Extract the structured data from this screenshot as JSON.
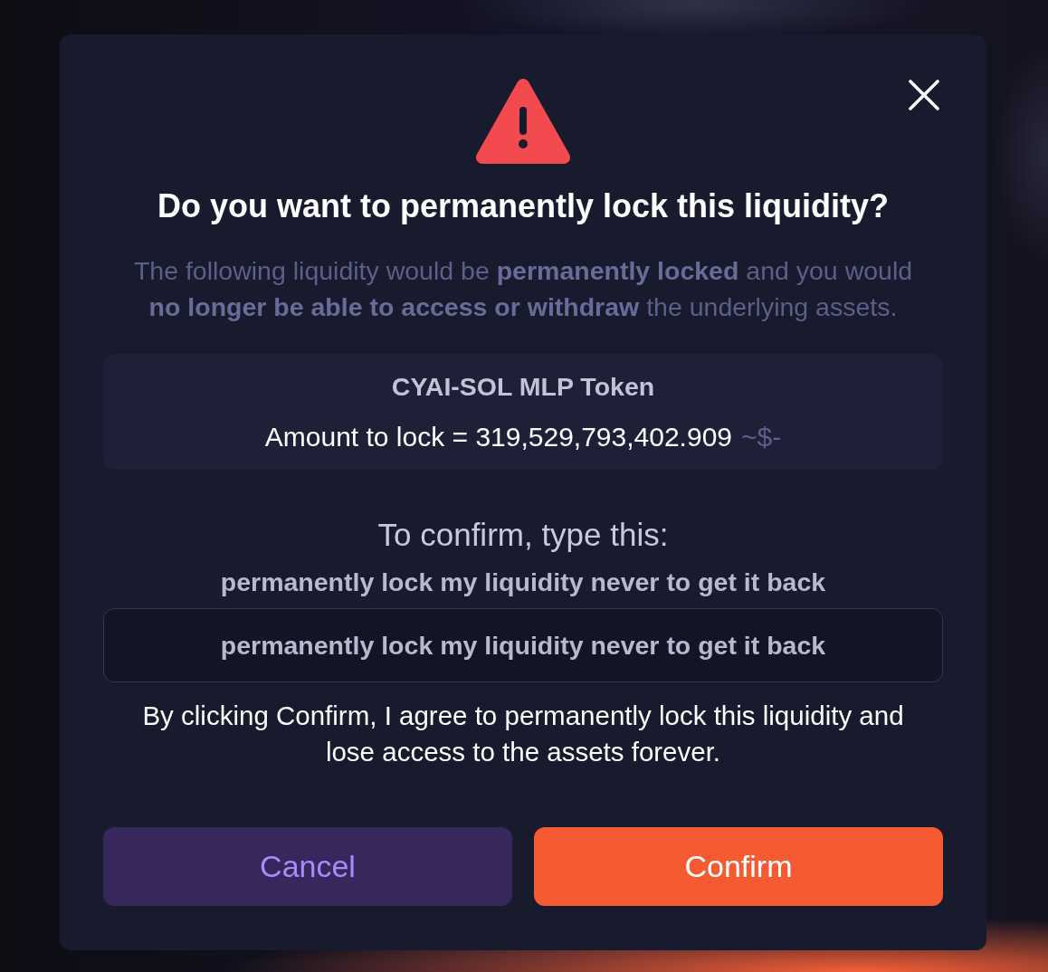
{
  "dialog": {
    "title": "Do you want to permanently lock this liquidity?",
    "description": "The following liquidity would be **permanently locked** and you would **no longer be able to access or withdraw** the underlying assets.",
    "token": {
      "name": "CYAI-SOL MLP Token",
      "amount_label": "Amount to lock = 319,529,793,402.909",
      "usd_value": "~$-"
    },
    "confirm_prompt": "To confirm, type this:",
    "confirm_phrase": "permanently lock my liquidity never to get it back",
    "input": {
      "value": "permanently lock my liquidity never to get it back"
    },
    "agreement": "By clicking Confirm, I agree to permanently lock this liquidity and lose access to the assets forever.",
    "buttons": [
      {
        "kind": "secondary",
        "label": "Cancel"
      },
      {
        "kind": "primary",
        "label": "Confirm"
      }
    ]
  }
}
